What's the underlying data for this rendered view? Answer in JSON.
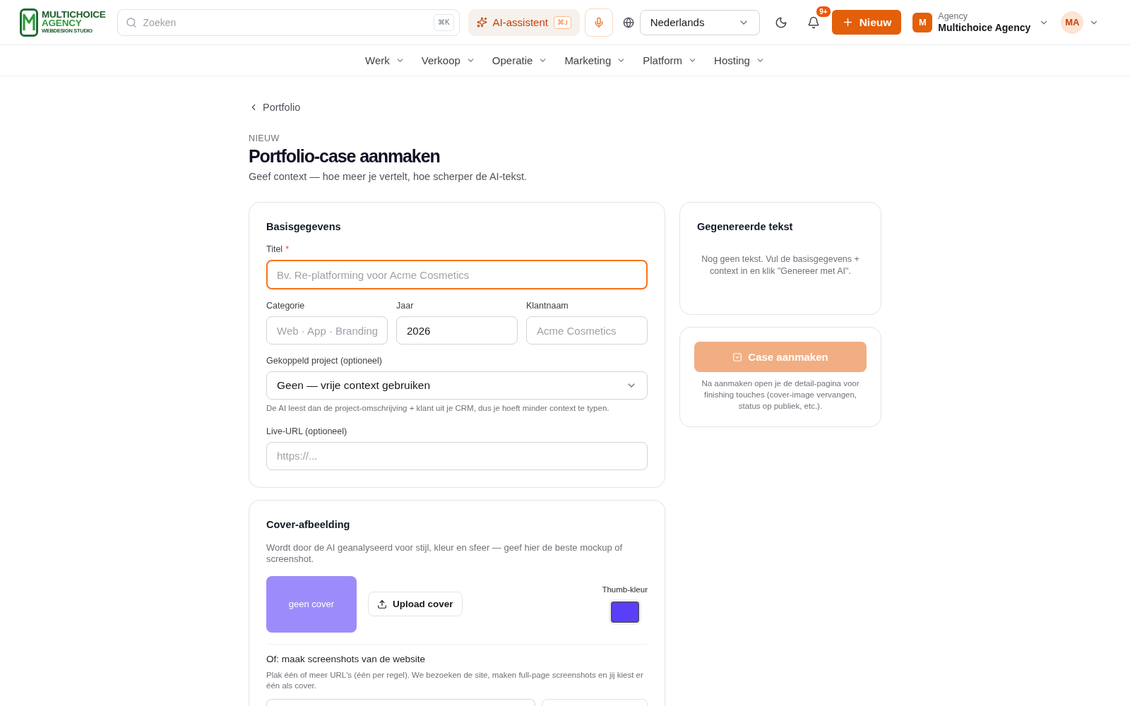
{
  "header": {
    "logo": {
      "title": "MULTICHOICE",
      "subtitle": "AGENCY",
      "tagline": "WEBDESIGN STUDIO"
    },
    "search": {
      "placeholder": "Zoeken",
      "shortcut": "⌘K"
    },
    "ai_assistant": {
      "label": "AI-assistent",
      "shortcut": "⌘J"
    },
    "language": "Nederlands",
    "notifications_badge": "9+",
    "new_button": "Nieuw",
    "workspace": {
      "initial": "M",
      "type": "Agency",
      "name": "Multichoice Agency"
    },
    "user_initials": "MA"
  },
  "nav": [
    "Werk",
    "Verkoop",
    "Operatie",
    "Marketing",
    "Platform",
    "Hosting"
  ],
  "breadcrumb": "Portfolio",
  "page": {
    "eyebrow": "NIEUW",
    "title": "Portfolio-case aanmaken",
    "subtitle": "Geef context — hoe meer je vertelt, hoe scherper de AI-tekst."
  },
  "basics": {
    "heading": "Basisgegevens",
    "title_field": {
      "label": "Titel",
      "required_mark": "*",
      "focused": true,
      "placeholder": "Bv. Re-platforming voor Acme Cosmetics"
    },
    "detail_fields": [
      {
        "label": "Categorie",
        "placeholder": "Web · App · Branding"
      },
      {
        "label": "Jaar",
        "value": "2026"
      },
      {
        "label": "Klantnaam",
        "placeholder": "Acme Cosmetics"
      }
    ],
    "project_field": {
      "label": "Gekoppeld project (optioneel)",
      "value": "Geen — vrije context gebruiken",
      "hint": "De AI leest dan de project-omschrijving + klant uit je CRM, dus je hoeft minder context te typen."
    },
    "url_field": {
      "label": "Live-URL (optioneel)",
      "placeholder": "https://..."
    }
  },
  "cover": {
    "heading": "Cover-afbeelding",
    "description": "Wordt door de AI geanalyseerd voor stijl, kleur en sfeer — geef hier de beste mockup of screenshot.",
    "placeholder_text": "geen cover",
    "upload_button": "Upload cover",
    "thumb_color": {
      "label": "Thumb-kleur",
      "color": "#5a3ff8"
    },
    "screenshots": {
      "heading": "Of: maak screenshots van de website",
      "hint": "Plak één of meer URL's (één per regel). We bezoeken de site, maken full-page screenshots en jij kiest er één als cover."
    }
  },
  "generated_text": {
    "heading": "Gegenereerde tekst",
    "empty_text": "Nog geen tekst. Vul de basisgegevens + context in en klik \"Genereer met AI\"."
  },
  "create": {
    "button": "Case aanmaken",
    "disabled": true,
    "note": "Na aanmaken open je de detail-pagina voor finishing touches (cover-image vervangen, status op publiek, etc.)."
  }
}
